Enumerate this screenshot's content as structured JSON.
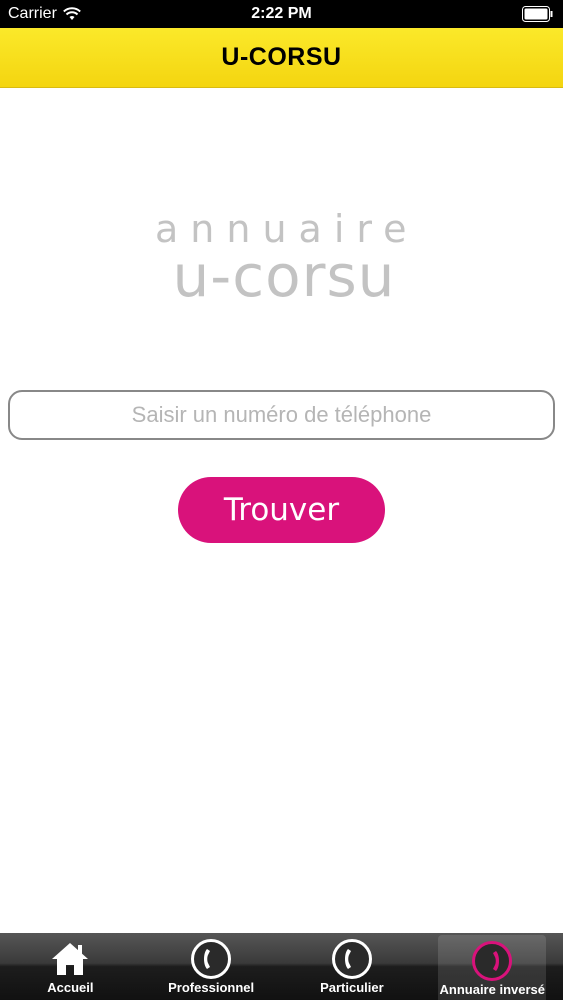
{
  "status_bar": {
    "carrier": "Carrier",
    "time": "2:22 PM"
  },
  "nav": {
    "title": "U-CORSU"
  },
  "logo": {
    "line1": "annuaire",
    "line2": "U-CORSU"
  },
  "search": {
    "value": "",
    "placeholder": "Saisir un numéro de téléphone"
  },
  "find_button": {
    "label": "Trouver"
  },
  "colors": {
    "brand_yellow": "#f7df1c",
    "accent_pink": "#d9127b"
  },
  "tabs": [
    {
      "label": "Accueil",
      "icon": "home-icon",
      "active": false
    },
    {
      "label": "Professionnel",
      "icon": "phone-icon",
      "active": false
    },
    {
      "label": "Particulier",
      "icon": "phone-icon",
      "active": false
    },
    {
      "label": "Annuaire inversé",
      "icon": "phone-icon",
      "active": true
    }
  ]
}
